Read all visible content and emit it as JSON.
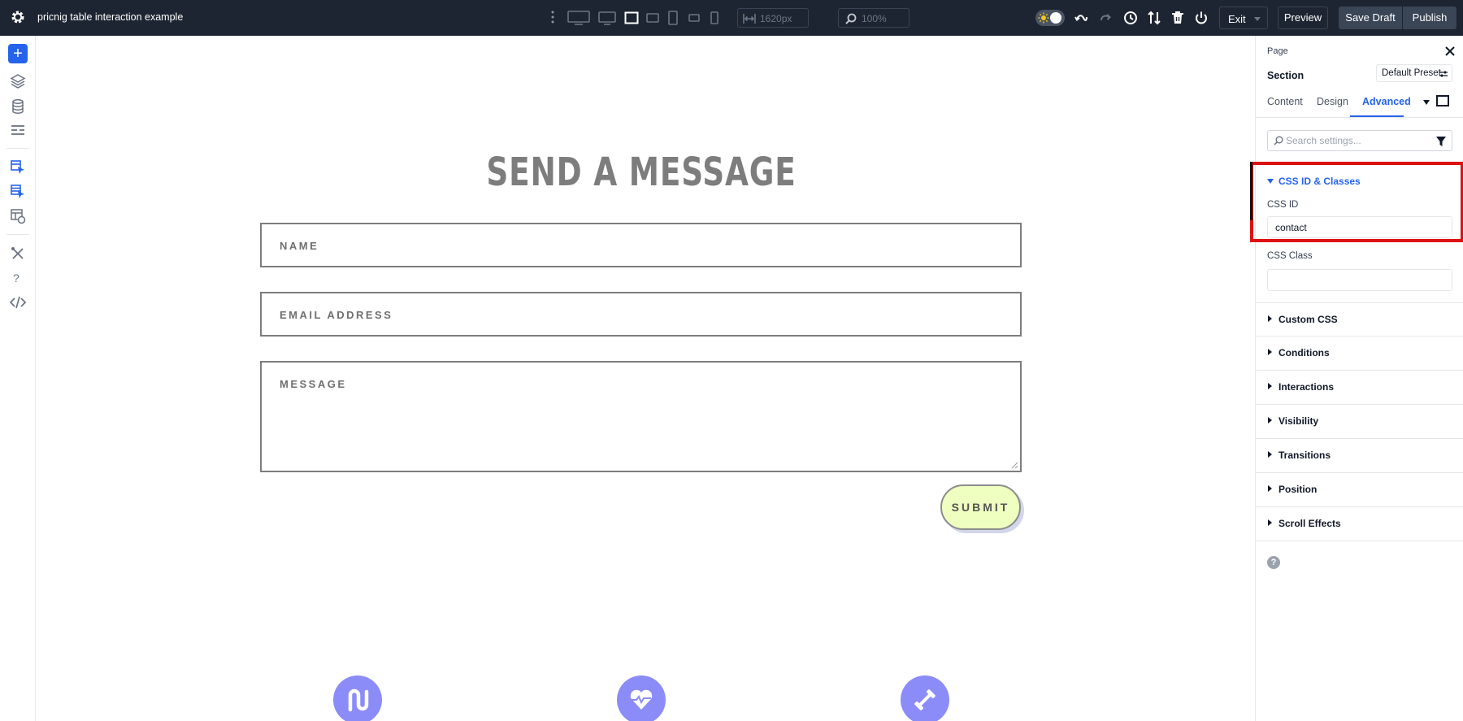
{
  "app": {
    "title": "pricnig table interaction example"
  },
  "toolbar": {
    "width_value": "1620px",
    "zoom_value": "100%",
    "exit_label": "Exit",
    "preview_label": "Preview",
    "save_draft_label": "Save Draft",
    "publish_label": "Publish"
  },
  "canvas": {
    "heading": "SEND A MESSAGE",
    "name_placeholder": "NAME",
    "email_placeholder": "EMAIL ADDRESS",
    "message_placeholder": "MESSAGE",
    "submit_label": "SUBMIT",
    "feature_icons": [
      "magnet-icon",
      "heart-icon",
      "dumbbell-icon"
    ]
  },
  "leftbar": {
    "help_label": "?",
    "icons": [
      "add-icon",
      "layers-icon",
      "database-icon",
      "layout-icon",
      "cursor-pages-icon",
      "cursor-stack-icon",
      "layout-clock-icon",
      "tools-icon",
      "help-icon",
      "code-icon"
    ]
  },
  "panel": {
    "breadcrumb": "Page",
    "section_title": "Section",
    "preset_label": "Default Preset",
    "tabs": [
      "Content",
      "Design",
      "Advanced"
    ],
    "active_tab": "Advanced",
    "search_placeholder": "Search settings...",
    "open_group": "CSS ID & Classes",
    "css_id_label": "CSS ID",
    "css_id_value": "contact",
    "css_class_label": "CSS Class",
    "css_class_value": "",
    "groups": [
      "Custom CSS",
      "Conditions",
      "Interactions",
      "Visibility",
      "Transitions",
      "Position",
      "Scroll Effects"
    ],
    "help_label": "?"
  },
  "colors": {
    "topbar": "#1e2532",
    "accent": "#2563eb",
    "highlight": "#dd1111",
    "submit_bg": "#efffc0",
    "feature_icon_bg": "#8b8cf8",
    "heading": "#7d7d7d"
  }
}
